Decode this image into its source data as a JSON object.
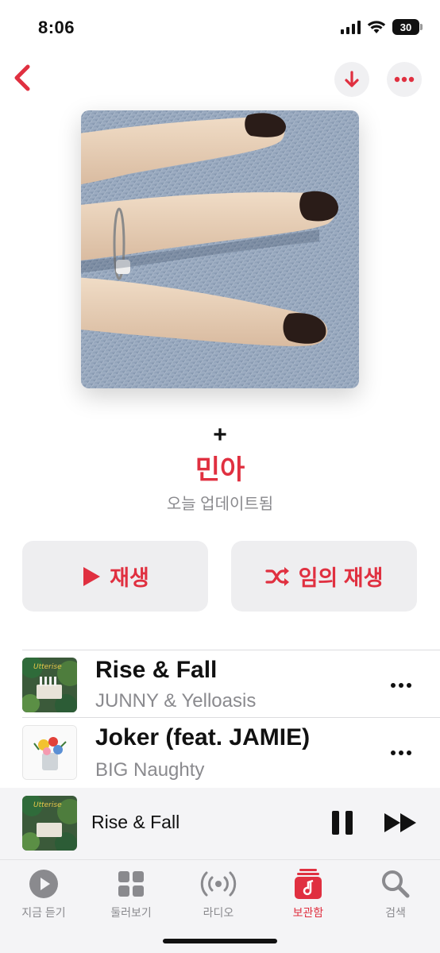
{
  "status": {
    "time": "8:06",
    "battery": "30"
  },
  "header": {
    "back_icon": "chevron-left-icon",
    "download_icon": "arrow-down-icon",
    "more_icon": "ellipsis-icon"
  },
  "playlist": {
    "symbol": "+",
    "title": "민아",
    "subtitle": "오늘 업데이트됨",
    "play_label": "재생",
    "shuffle_label": "임의 재생"
  },
  "tracks": [
    {
      "title": "Rise & Fall",
      "artist": "JUNNY & Yelloasis"
    },
    {
      "title": "Joker (feat. JAMIE)",
      "artist": "BIG Naughty"
    }
  ],
  "now_playing": {
    "title": "Rise & Fall",
    "state": "playing"
  },
  "tabs": [
    {
      "label": "지금 듣기",
      "icon": "play-circle-icon",
      "active": false
    },
    {
      "label": "둘러보기",
      "icon": "grid-icon",
      "active": false
    },
    {
      "label": "라디오",
      "icon": "radio-icon",
      "active": false
    },
    {
      "label": "보관함",
      "icon": "library-icon",
      "active": true
    },
    {
      "label": "검색",
      "icon": "search-icon",
      "active": false
    }
  ],
  "colors": {
    "accent": "#e03040",
    "secondary_text": "#8a8a8e",
    "button_bg": "#eeeef0"
  }
}
